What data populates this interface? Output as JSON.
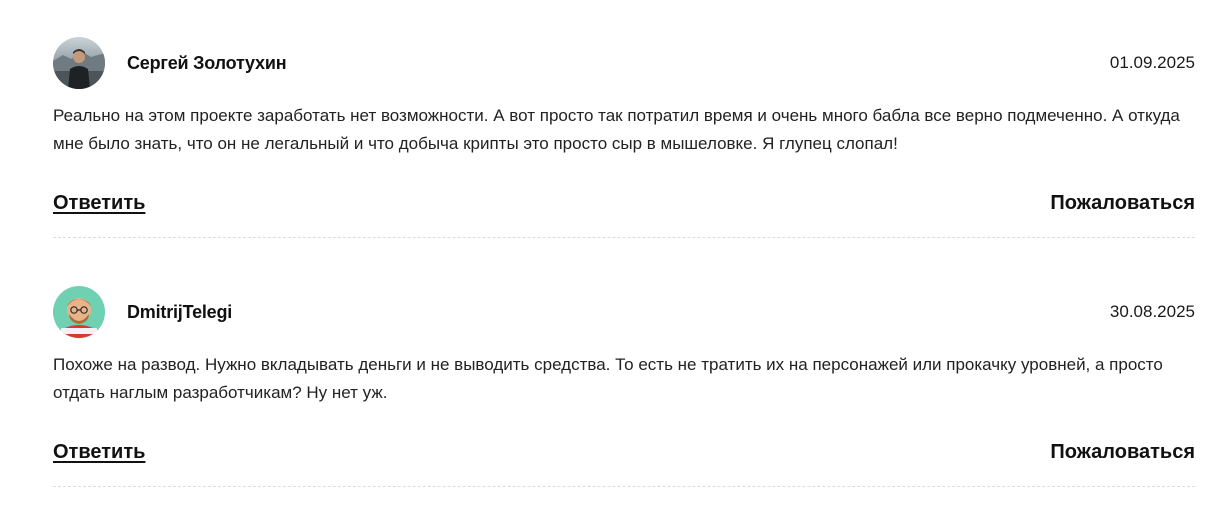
{
  "comments": [
    {
      "author": "Сергей Золотухин",
      "date": "01.09.2025",
      "text": "Реально на этом проекте заработать нет возможности. А вот просто так потратил время и очень много бабла все верно подмеченно. А откуда мне было знать, что он не легальный и что добыча крипты это просто сыр в мышеловке. Я глупец слопал!",
      "reply_label": "Ответить",
      "report_label": "Пожаловаться"
    },
    {
      "author": "DmitrijTelegi",
      "date": "30.08.2025",
      "text": "Похоже на развод. Нужно вкладывать деньги и не выводить средства. То есть не тратить их на персонажей или прокачку уровней, а просто отдать наглым разработчикам? Ну нет уж.",
      "reply_label": "Ответить",
      "report_label": "Пожаловаться"
    }
  ]
}
